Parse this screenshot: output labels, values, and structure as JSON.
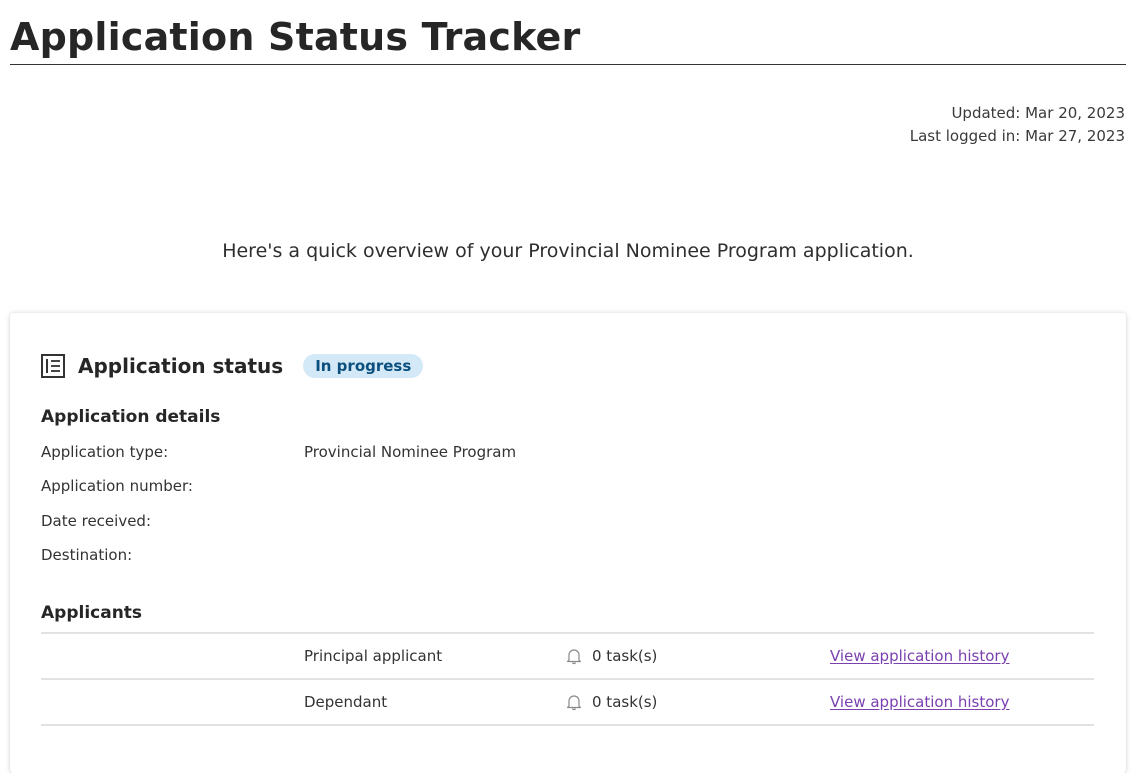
{
  "page": {
    "title": "Application Status Tracker"
  },
  "meta": {
    "updated": "Updated: Mar 20, 2023",
    "last_logged_in": "Last logged in: Mar 27, 2023"
  },
  "intro": "Here's a quick overview of your Provincial Nominee Program application.",
  "status": {
    "icon": "list-document-icon",
    "title": "Application status",
    "badge": "In progress",
    "badge_bg": "#d4e9f7",
    "badge_color": "#0a4f7e"
  },
  "details": {
    "heading": "Application details",
    "rows": [
      {
        "label": "Application type:",
        "value": "Provincial Nominee Program"
      },
      {
        "label": "Application number:",
        "value": ""
      },
      {
        "label": "Date received:",
        "value": ""
      },
      {
        "label": "Destination:",
        "value": ""
      }
    ]
  },
  "applicants": {
    "heading": "Applicants",
    "rows": [
      {
        "role": "Principal applicant",
        "tasks": "0 task(s)",
        "task_icon": "bell-icon",
        "link": "View application history"
      },
      {
        "role": "Dependant",
        "tasks": "0 task(s)",
        "task_icon": "bell-icon",
        "link": "View application history"
      }
    ],
    "link_color": "#7a40b0"
  }
}
